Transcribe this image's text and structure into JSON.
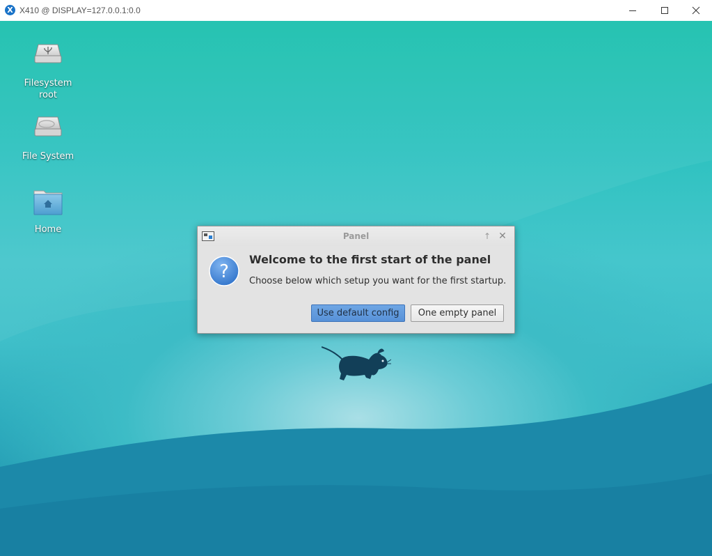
{
  "host_window": {
    "title": "X410 @ DISPLAY=127.0.0.1:0.0",
    "app_icon_letter": "X",
    "controls": [
      "minimize",
      "maximize",
      "close"
    ]
  },
  "desktop": {
    "icons": [
      {
        "label": "Filesystem root",
        "icon": "usb-drive-icon"
      },
      {
        "label": "File System",
        "icon": "hard-drive-icon"
      },
      {
        "label": "Home",
        "icon": "home-folder-icon"
      }
    ],
    "background_colors": {
      "top": "#1bc0ad",
      "bottom": "#1b88a8"
    }
  },
  "dialog": {
    "title": "Panel",
    "heading": "Welcome to the first start of the panel",
    "message": "Choose below which setup you want for the first startup.",
    "buttons": {
      "default": "Use default config",
      "empty": "One empty panel"
    },
    "accent_color": "#5b94da"
  }
}
